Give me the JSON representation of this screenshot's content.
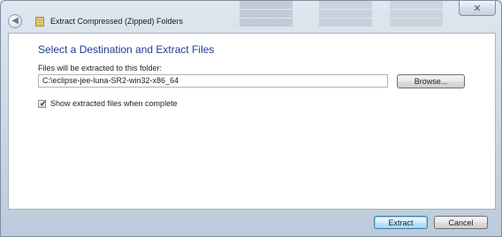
{
  "window": {
    "title": "Extract Compressed (Zipped) Folders",
    "close_glyph": "✕",
    "back_glyph": "◀"
  },
  "dialog": {
    "heading": "Select a Destination and Extract Files",
    "path_label": "Files will be extracted to this folder:",
    "path_value": "C:\\eclipse-jee-luna-SR2-win32-x86_64",
    "browse_label": "Browse...",
    "show_files_label": "Show extracted files when complete",
    "show_files_checked": true,
    "checkmark_glyph": "✔"
  },
  "footer": {
    "extract_label": "Extract",
    "cancel_label": "Cancel"
  },
  "colors": {
    "heading": "#1d3d8f",
    "frame": "#c9d6e3",
    "default_button_border": "#3c7fb1"
  },
  "icons": {
    "back": "back-arrow-icon",
    "folder": "zipped-folder-icon",
    "close": "close-icon",
    "check": "checkmark-icon"
  }
}
